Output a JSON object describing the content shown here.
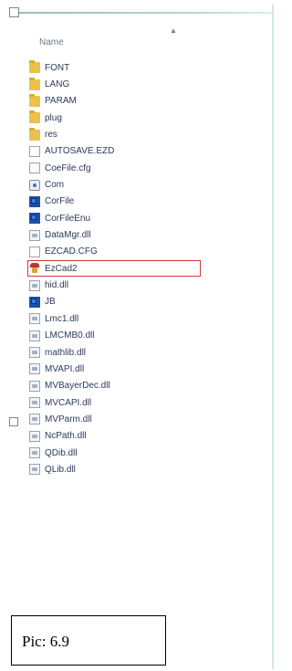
{
  "header": {
    "name_column": "Name"
  },
  "files": [
    {
      "name": "FONT",
      "icon": "folder-icon"
    },
    {
      "name": "LANG",
      "icon": "folder-icon"
    },
    {
      "name": "PARAM",
      "icon": "folder-icon"
    },
    {
      "name": "plug",
      "icon": "folder-icon"
    },
    {
      "name": "res",
      "icon": "folder-icon"
    },
    {
      "name": "AUTOSAVE.EZD",
      "icon": "doc-icon"
    },
    {
      "name": "CoeFile.cfg",
      "icon": "doc-icon"
    },
    {
      "name": "Com",
      "icon": "com-icon"
    },
    {
      "name": "CorFile",
      "icon": "app-icon"
    },
    {
      "name": "CorFileEnu",
      "icon": "app-icon"
    },
    {
      "name": "DataMgr.dll",
      "icon": "dll-icon"
    },
    {
      "name": "EZCAD.CFG",
      "icon": "doc-icon"
    },
    {
      "name": "EzCad2",
      "icon": "ezcad-icon"
    },
    {
      "name": "hid.dll",
      "icon": "dll-icon"
    },
    {
      "name": "JB",
      "icon": "app-icon"
    },
    {
      "name": "Lmc1.dll",
      "icon": "dll-icon"
    },
    {
      "name": "LMCMB0.dll",
      "icon": "dll-icon"
    },
    {
      "name": "mathlib.dll",
      "icon": "dll-icon"
    },
    {
      "name": "MVAPI.dll",
      "icon": "dll-icon"
    },
    {
      "name": "MVBayerDec.dll",
      "icon": "dll-icon"
    },
    {
      "name": "MVCAPI.dll",
      "icon": "dll-icon"
    },
    {
      "name": "MVParm.dll",
      "icon": "dll-icon"
    },
    {
      "name": "NcPath.dll",
      "icon": "dll-icon"
    },
    {
      "name": "QDib.dll",
      "icon": "dll-icon"
    },
    {
      "name": "QLib.dll",
      "icon": "dll-icon"
    }
  ],
  "highlighted_file": "EzCad2",
  "caption": "Pic: 6.9"
}
